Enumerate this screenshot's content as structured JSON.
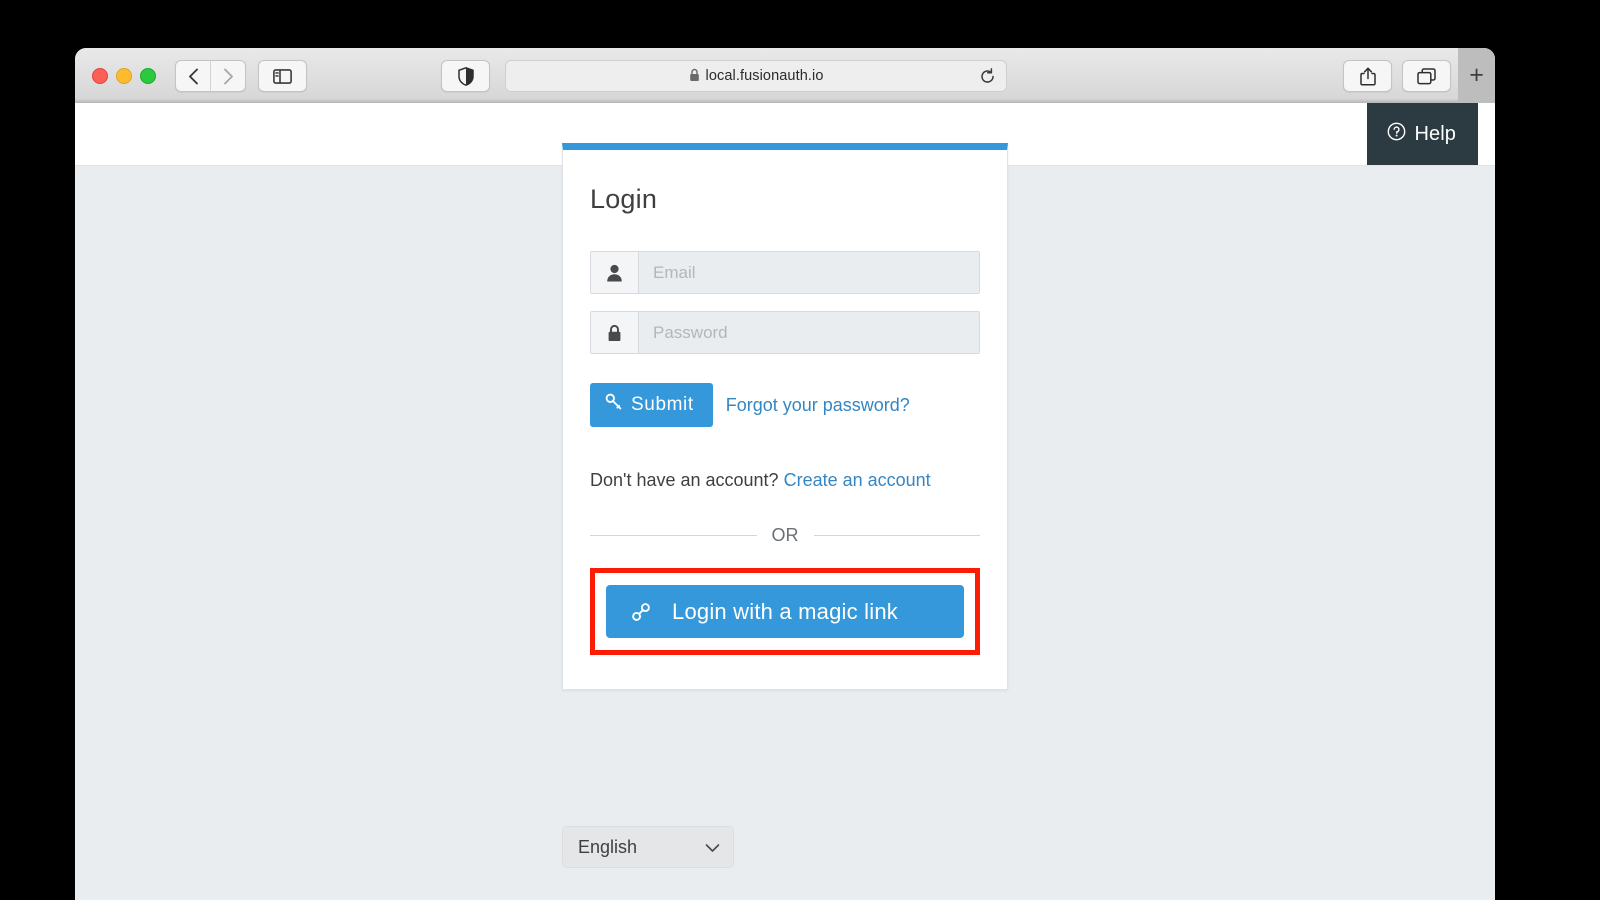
{
  "browser": {
    "url": "local.fusionauth.io",
    "back_label": "Back",
    "forward_label": "Forward",
    "sidebar_label": "Sidebar",
    "shield_label": "Privacy Report",
    "share_label": "Share",
    "tabs_label": "Tab Overview",
    "newtab_label": "+",
    "reload_label": "Reload"
  },
  "header": {
    "help_label": "Help"
  },
  "login": {
    "title": "Login",
    "email": {
      "value": "",
      "placeholder": "Email"
    },
    "password": {
      "value": "",
      "placeholder": "Password"
    },
    "submit_label": "Submit",
    "forgot_label": "Forgot your password?",
    "account_prompt": "Don't have an account?",
    "create_account_label": "Create an account",
    "or_label": "OR",
    "magic_link_label": "Login with a magic link"
  },
  "language": {
    "selected": "English"
  },
  "colors": {
    "accent": "#3498db",
    "link": "#3486c4",
    "highlight": "#fc1b05",
    "help_bar": "#2b3b41",
    "page_bg": "#e9edf0"
  }
}
